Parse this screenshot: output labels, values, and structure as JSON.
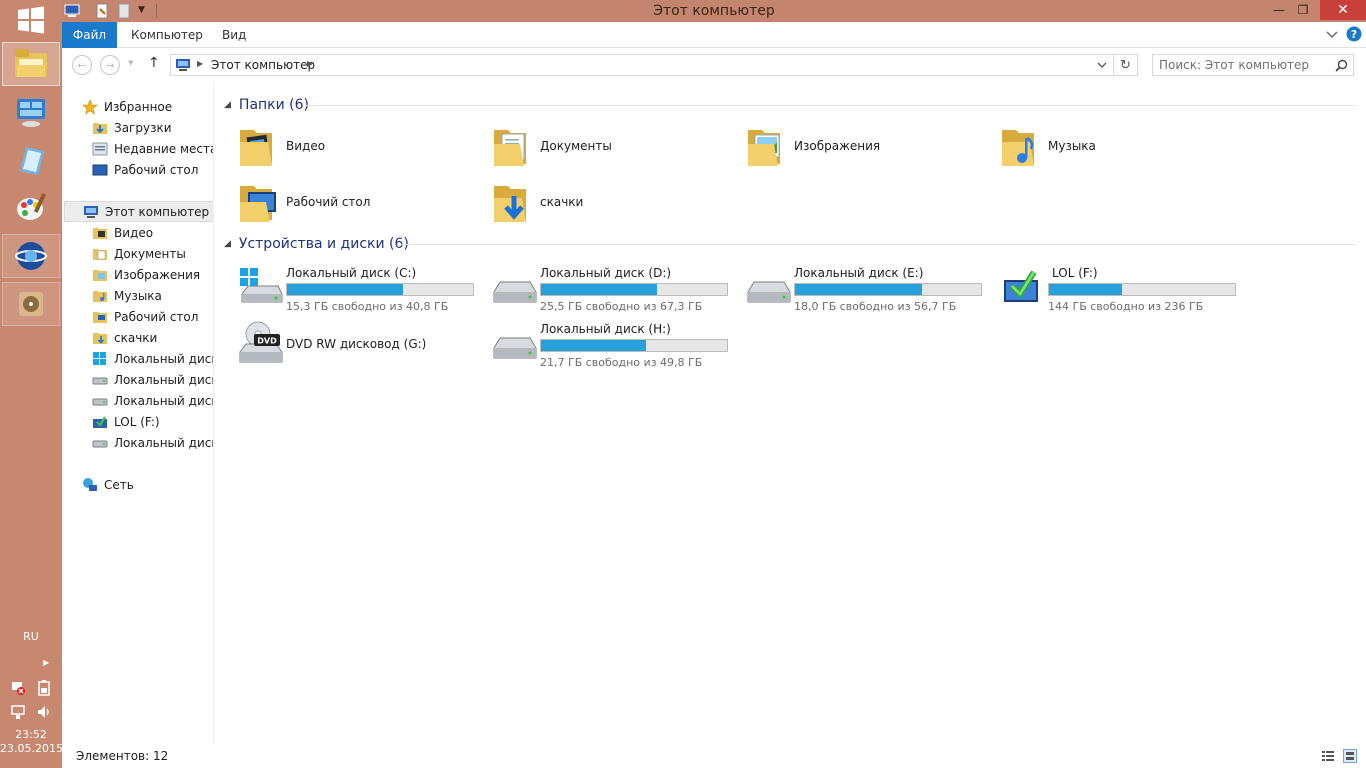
{
  "taskbar": {
    "lang": "RU",
    "time": "23:52",
    "date": "23.05.2015"
  },
  "window": {
    "title": "Этот компьютер",
    "controls": {
      "minimize": "—",
      "maximize": "❐",
      "close": "✕"
    }
  },
  "ribbon": {
    "tabs": [
      "Файл",
      "Компьютер",
      "Вид"
    ]
  },
  "address": {
    "path": "Этот компьютер",
    "search_placeholder": "Поиск: Этот компьютер"
  },
  "nav": {
    "favorites": {
      "label": "Избранное",
      "items": [
        "Загрузки",
        "Недавние места",
        "Рабочий стол"
      ]
    },
    "this_pc": {
      "label": "Этот компьютер",
      "items": [
        "Видео",
        "Документы",
        "Изображения",
        "Музыка",
        "Рабочий стол",
        "скачки",
        "Локальный диск (",
        "Локальный диск (",
        "Локальный диск (",
        "LOL (F:)",
        "Локальный диск ("
      ]
    },
    "network": {
      "label": "Сеть"
    }
  },
  "folders": {
    "header": "Папки (6)",
    "items": [
      "Видео",
      "Документы",
      "Изображения",
      "Музыка",
      "Рабочий стол",
      "скачки"
    ]
  },
  "drives": {
    "header": "Устройства и диски (6)",
    "items": [
      {
        "name": "Локальный диск (C:)",
        "free": "15,3 ГБ свободно из 40,8 ГБ",
        "used_fraction": 0.625
      },
      {
        "name": "Локальный диск (D:)",
        "free": "25,5 ГБ свободно из 67,3 ГБ",
        "used_fraction": 0.621
      },
      {
        "name": "Локальный диск (E:)",
        "free": "18,0 ГБ свободно из 56,7 ГБ",
        "used_fraction": 0.683
      },
      {
        "name": "LOL (F:)",
        "free": "144 ГБ свободно из 236 ГБ",
        "used_fraction": 0.39
      },
      {
        "name": "DVD RW дисковод (G:)"
      },
      {
        "name": "Локальный диск (H:)",
        "free": "21,7 ГБ свободно из 49,8 ГБ",
        "used_fraction": 0.564
      }
    ]
  },
  "status": {
    "items_count": "Элементов: 12"
  },
  "colors": {
    "accent": "#1979ca",
    "progress": "#26a0da",
    "header_text": "#1e3287",
    "taskbar": "#c8886f"
  }
}
